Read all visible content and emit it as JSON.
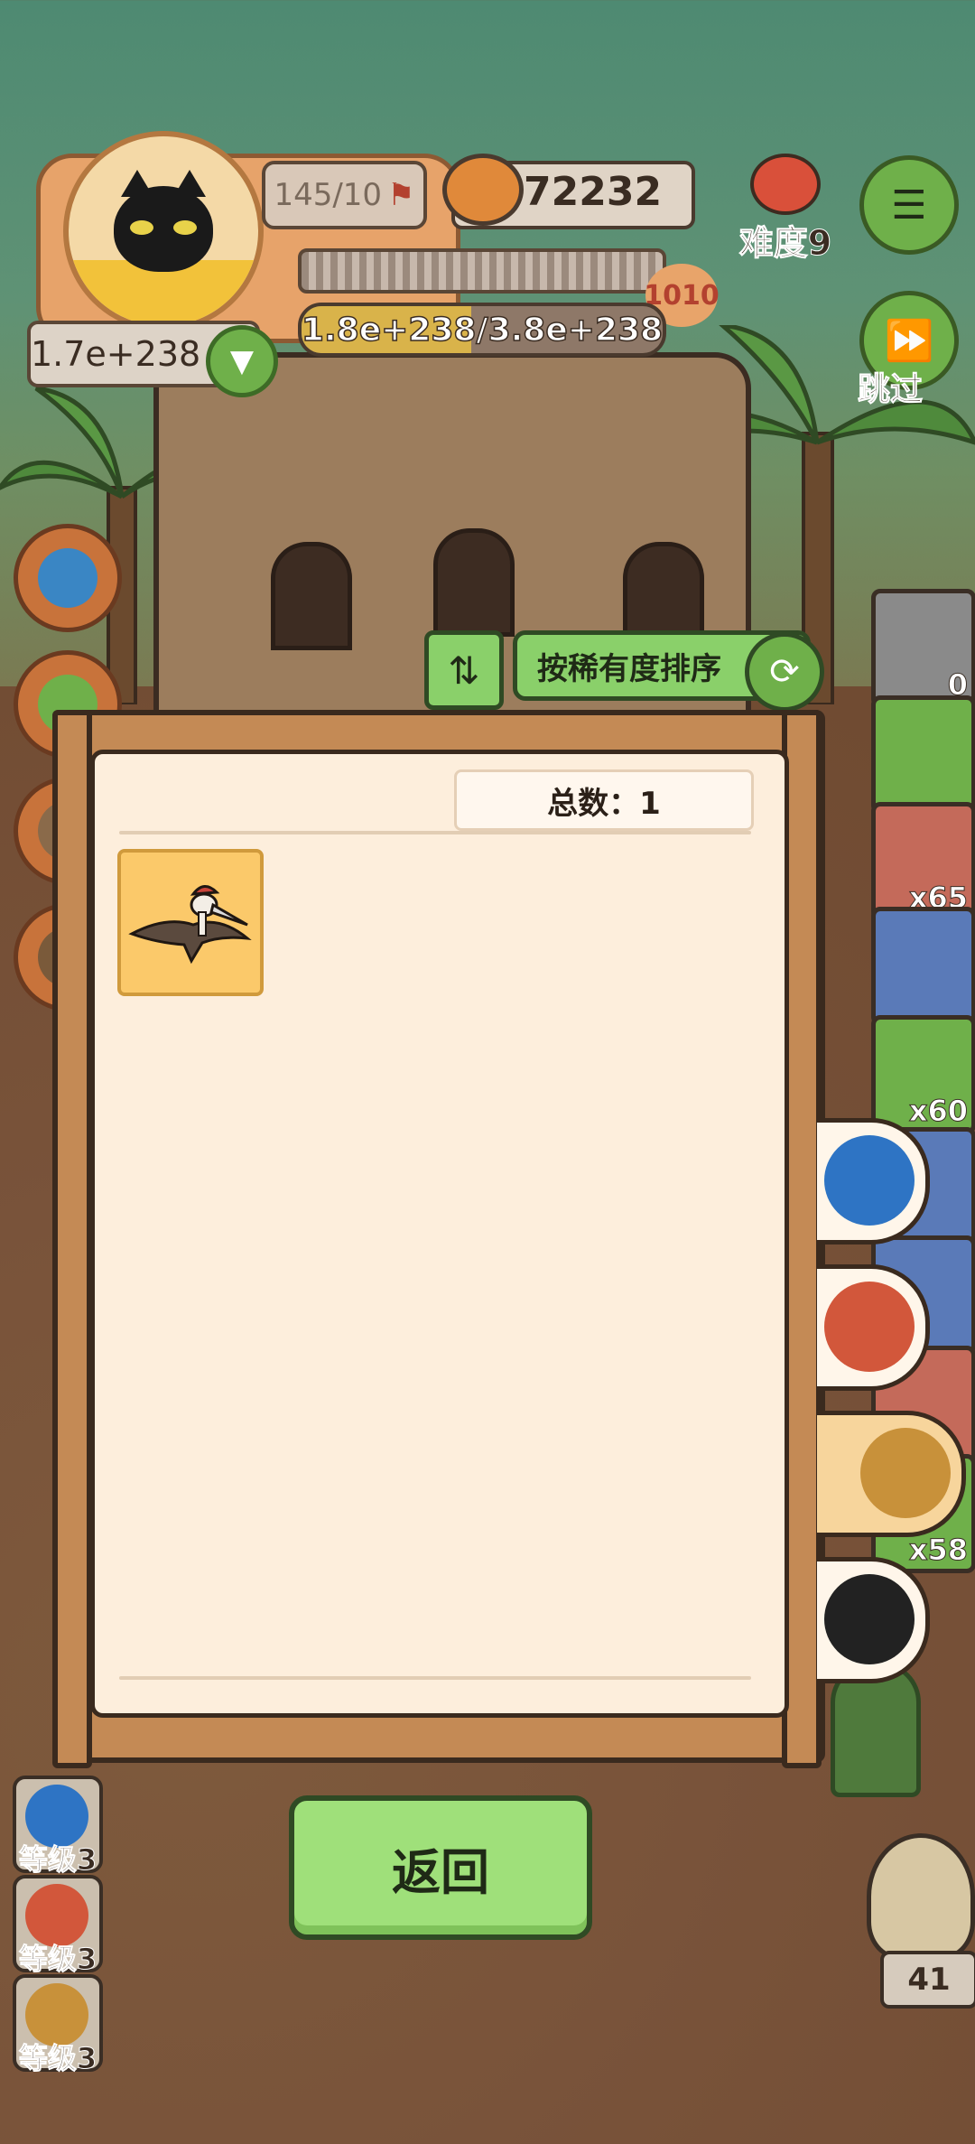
{
  "hud": {
    "stage_progress": "145/10",
    "coins": "72232",
    "level_badge": "1010",
    "hp_text": "1.8e+238/3.8e+238",
    "hp_fraction": 0.47,
    "power": "1.7e+238",
    "difficulty_label": "难度9",
    "skip_label": "跳过"
  },
  "inventory": [
    {
      "name": "ore-rock",
      "count": "0",
      "color": "#8a8a8a"
    },
    {
      "name": "credit-card",
      "count": "",
      "color": "#6fb04a"
    },
    {
      "name": "snorkel-mask",
      "count": "x65",
      "color": "#c46a5a"
    },
    {
      "name": "treasure-chest",
      "count": "",
      "color": "#5a7ab8"
    },
    {
      "name": "lollipop",
      "count": "x60",
      "color": "#6fb04a"
    },
    {
      "name": "trophy",
      "count": "",
      "color": "#5a7ab8"
    },
    {
      "name": "fly",
      "count": "",
      "color": "#5a7ab8"
    },
    {
      "name": "green-orb",
      "count": "",
      "color": "#c46a5a"
    },
    {
      "name": "hammer",
      "count": "x58",
      "color": "#6fb04a"
    }
  ],
  "sort": {
    "label": "按稀有度排序"
  },
  "collection": {
    "total_label": "总数：1",
    "items": [
      {
        "name": "pterodactyl"
      }
    ]
  },
  "return_label": "返回",
  "tabs": [
    {
      "name": "blob",
      "color": "#2e74c4",
      "active": false
    },
    {
      "name": "creature",
      "color": "#d2573b",
      "active": false
    },
    {
      "name": "fossil-skull",
      "color": "#c8913a",
      "active": true
    },
    {
      "name": "paw",
      "color": "#222222",
      "active": false
    }
  ],
  "levels": [
    {
      "label": "等级3",
      "color": "#2e74c4"
    },
    {
      "label": "等级3",
      "color": "#d2573b"
    },
    {
      "label": "等级3",
      "color": "#c8913a"
    }
  ],
  "bird_count": "41"
}
